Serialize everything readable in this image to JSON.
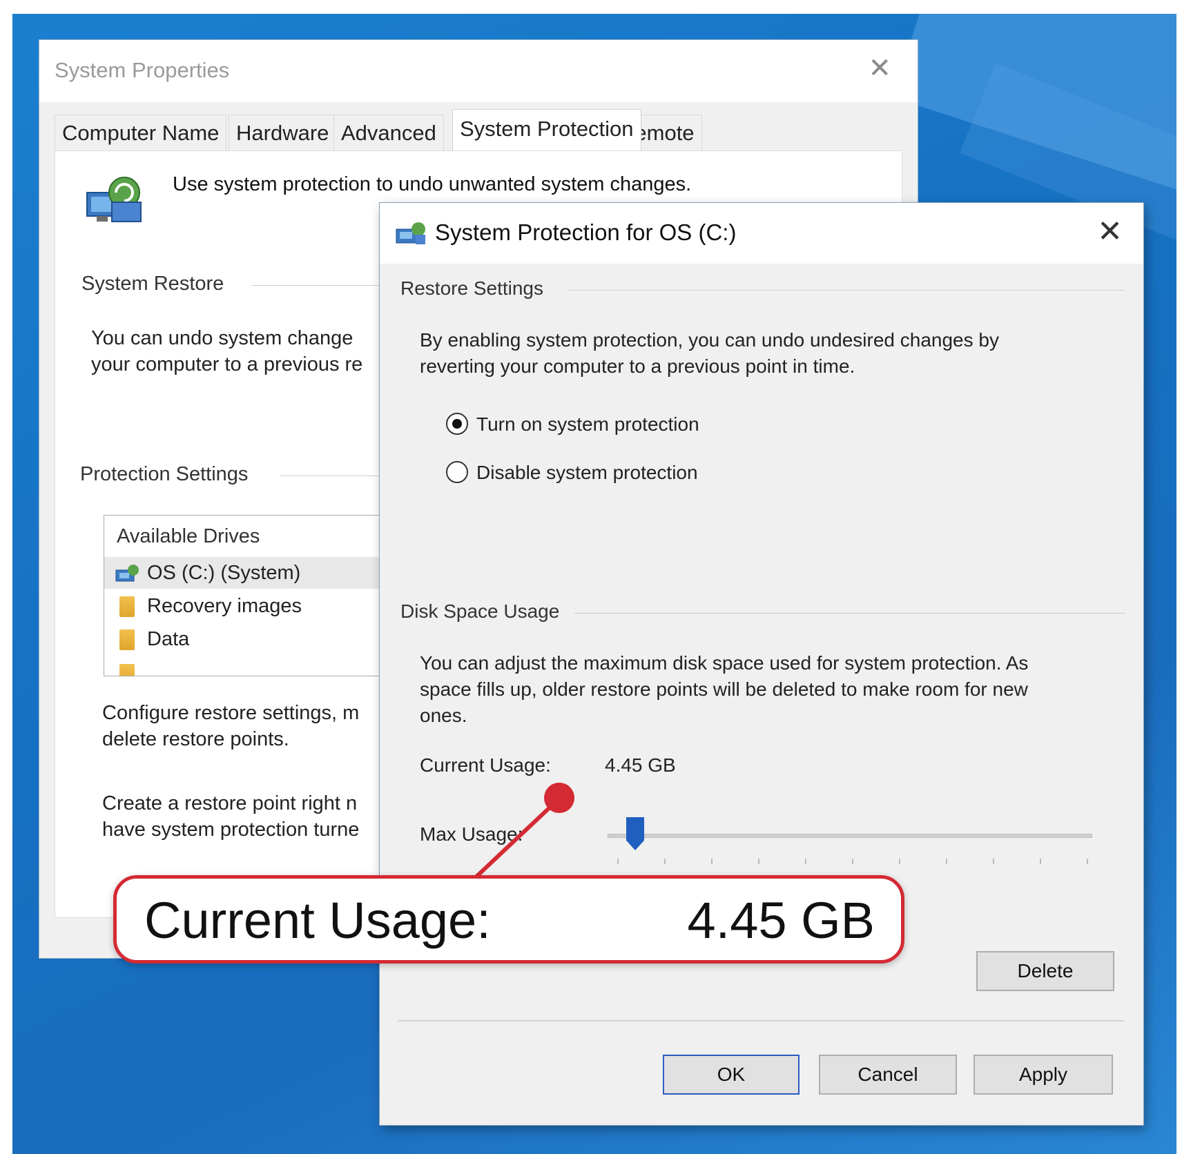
{
  "system_properties": {
    "title": "System Properties",
    "tabs": [
      "Computer Name",
      "Hardware",
      "Advanced",
      "System Protection",
      "Remote"
    ],
    "active_tab": "System Protection",
    "intro": "Use system protection to undo unwanted system changes.",
    "system_restore_label": "System Restore",
    "system_restore_text": [
      "You can undo system change",
      "your computer to a previous re"
    ],
    "protection_settings_label": "Protection Settings",
    "drives_header": "Available Drives",
    "drives": [
      "OS (C:) (System)",
      "Recovery images",
      "Data"
    ],
    "configure_text": [
      "Configure restore settings, m",
      "delete restore points."
    ],
    "create_text": [
      "Create a restore point right n",
      "have system protection turne"
    ]
  },
  "dialog": {
    "title": "System Protection for OS (C:)",
    "restore_settings_label": "Restore Settings",
    "restore_desc": [
      "By enabling system protection, you can undo undesired changes by",
      "reverting your computer to a previous point in time."
    ],
    "radio_on": "Turn on system protection",
    "radio_off": "Disable system protection",
    "selected_option": "Turn on system protection",
    "disk_usage_label": "Disk Space Usage",
    "disk_desc": [
      "You can adjust the maximum disk space used for system protection. As",
      "space fills up, older restore points will be deleted to make room for new",
      "ones."
    ],
    "current_usage_label": "Current Usage:",
    "current_usage_value": "4.45 GB",
    "max_usage_label": "Max Usage:",
    "delete_label": "Delete",
    "ok_label": "OK",
    "cancel_label": "Cancel",
    "apply_label": "Apply"
  },
  "callout": {
    "label": "Current Usage:",
    "value": "4.45 GB",
    "color": "#d42a33"
  },
  "colors": {
    "desktop": "#1b7fcf",
    "accent": "#1f5fbf"
  }
}
